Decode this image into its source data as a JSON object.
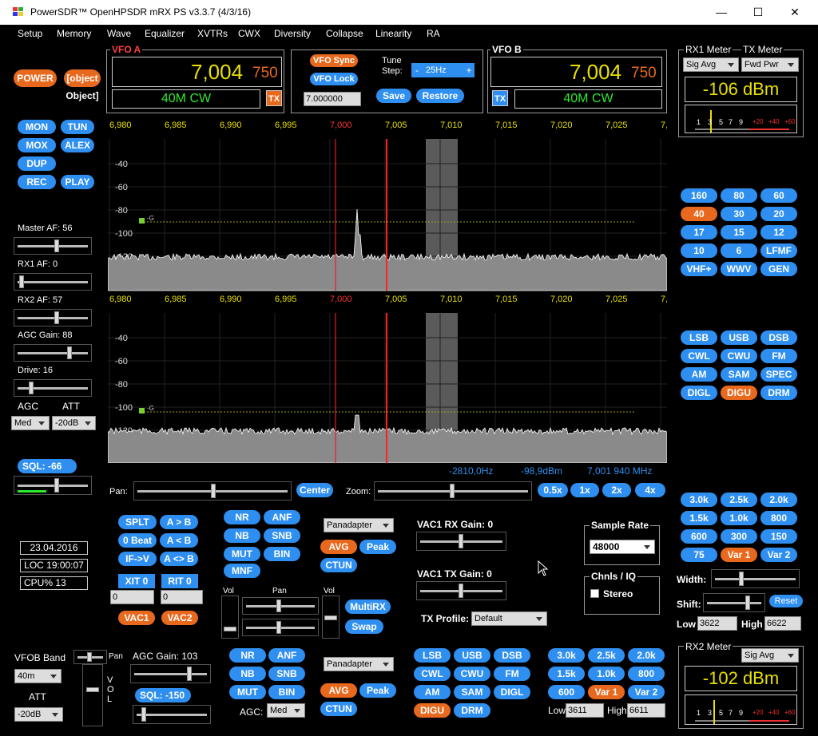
{
  "title": "PowerSDR™ OpenHPSDR mRX PS v3.3.7 (4/3/16)",
  "menu": [
    "Setup",
    "Memory",
    "Wave",
    "Equalizer",
    "XVTRs",
    "CWX",
    "Diversity",
    "Collapse",
    "Linearity",
    "RA"
  ],
  "power": "POWER",
  "rx2": {
    "agc_gain": "AGC Gain:  103",
    "sql": "SQL:  -150",
    "agc_label": "AGC:",
    "agc": "Med",
    "panadapter": "Panadapter",
    "avg": "AVG",
    "peak": "Peak",
    "ctun": "CTUN"
  },
  "vfoa": {
    "label": "VFO A",
    "freq_main": "7,004",
    "freq_sub": "750",
    "band": "40M CW",
    "tx": "TX"
  },
  "vfob": {
    "label": "VFO B",
    "freq_main": "7,004",
    "freq_sub": "750",
    "band": "40M CW",
    "tx": "TX"
  },
  "center": {
    "vfo_sync": "VFO Sync",
    "vfo_lock": "VFO Lock",
    "tune_label": "Tune",
    "step_label": "Step:",
    "step": "25Hz",
    "minus": "-",
    "plus": "+",
    "freq_entry": "7.000000",
    "save": "Save",
    "restore": "Restore"
  },
  "meters": {
    "rx1_label": "RX1 Meter",
    "tx_label": "TX Meter",
    "rx1_mode": "Sig Avg",
    "tx_mode": "Fwd Pwr",
    "rx1_value": "-106 dBm",
    "rx2_label": "RX2 Meter",
    "rx2_mode": "Sig Avg",
    "rx2_value": "-102 dBm",
    "scale": [
      "1",
      "3",
      "5",
      "7",
      "9",
      "+20",
      "+40",
      "+60"
    ]
  },
  "left_buttons": [
    "MON",
    "TUN",
    "MOX",
    "ALEX",
    "DUP",
    "REC",
    "PLAY"
  ],
  "sliders": {
    "master_af": "Master AF:  56",
    "rx1_af": "RX1 AF:  0",
    "rx2_af": "RX2 AF:  57",
    "agc_gain": "AGC Gain:  88",
    "drive": "Drive:  16"
  },
  "agc": {
    "agc_label": "AGC",
    "att_label": "ATT",
    "agc": "Med",
    "att": "-20dB"
  },
  "sql": "SQL:  -66",
  "status": {
    "date": "23.04.2016",
    "loc": "LOC 19:00:07",
    "cpu": "CPU%  13"
  },
  "freq_ticks": [
    "6,980",
    "6,985",
    "6,990",
    "6,995",
    "7,000",
    "7,005",
    "7,010",
    "7,015",
    "7,020",
    "7,025",
    "7,0"
  ],
  "db_ticks": [
    "-40",
    "-60",
    "-80",
    "-100",
    "-120"
  ],
  "db_ticks2": [
    "-40",
    "-60",
    "-80",
    "-100",
    "-120"
  ],
  "g_label": "-G",
  "cursor": {
    "offset": "-2810,0Hz",
    "dbm": "-98,9dBm",
    "freq": "7,001 940 MHz"
  },
  "pan": {
    "pan_label": "Pan:",
    "center": "Center",
    "zoom_label": "Zoom:",
    "zoom": [
      "0.5x",
      "1x",
      "2x",
      "4x"
    ]
  },
  "bands": [
    "160",
    "80",
    "60",
    "40",
    "30",
    "20",
    "17",
    "15",
    "12",
    "10",
    "6",
    "LFMF",
    "VHF+",
    "WWV",
    "GEN"
  ],
  "modes": [
    "LSB",
    "USB",
    "DSB",
    "CWL",
    "CWU",
    "FM",
    "AM",
    "SAM",
    "SPEC",
    "DIGL",
    "DIGU",
    "DRM"
  ],
  "filters": [
    "3.0k",
    "2.5k",
    "2.0k",
    "1.5k",
    "1.0k",
    "800",
    "600",
    "300",
    "150",
    "75",
    "Var 1",
    "Var 2"
  ],
  "filter_ctrl": {
    "width": "Width:",
    "shift": "Shift:",
    "reset": "Reset",
    "low_label": "Low",
    "low": "3622",
    "high_label": "High",
    "high": "6622"
  },
  "rx1_dsp": {
    "splt": "SPLT",
    "a_b": "A > B",
    "zero_beat": "0 Beat",
    "b_a": "A < B",
    "if_v": "IF->V",
    "a_swap": "A <> B",
    "xit": "XIT  0",
    "rit": "RIT  0",
    "xit_val": "0",
    "rit_val": "0",
    "vac1": "VAC1",
    "vac2": "VAC2"
  },
  "dsp": [
    "NR",
    "ANF",
    "NB",
    "SNB",
    "MUT",
    "BIN",
    "MNF"
  ],
  "panadapter": "Panadapter",
  "avg": "AVG",
  "peak": "Peak",
  "ctun": "CTUN",
  "vac": {
    "rx_gain": "VAC1  RX Gain:  0",
    "tx_gain": "VAC1  TX Gain:  0",
    "tx_profile_label": "TX Profile:",
    "tx_profile": "Default"
  },
  "sample": {
    "label": "Sample Rate",
    "value": "48000",
    "chnls": "Chnls / IQ",
    "stereo": "Stereo"
  },
  "mix": {
    "vol": "Vol",
    "pan": "Pan",
    "vol2": "Vol",
    "multirx": "MultiRX",
    "swap": "Swap"
  },
  "vfob_band": {
    "label": "VFOB Band",
    "band": "40m",
    "att_label": "ATT",
    "att": "-20dB",
    "pan": "Pan",
    "vol": "V\nO\nL"
  },
  "rx2_modes": [
    "LSB",
    "USB",
    "DSB",
    "CWL",
    "CWU",
    "FM",
    "AM",
    "SAM",
    "DIGL",
    "DIGU",
    "DRM"
  ],
  "rx2_filters": [
    "3.0k",
    "2.5k",
    "2.0k",
    "1.5k",
    "1.0k",
    "800",
    "600",
    "Var 1",
    "Var 2"
  ],
  "rx2_filter_ctrl": {
    "low_label": "Low",
    "low": "3611",
    "high_label": "High",
    "high": "6611"
  }
}
